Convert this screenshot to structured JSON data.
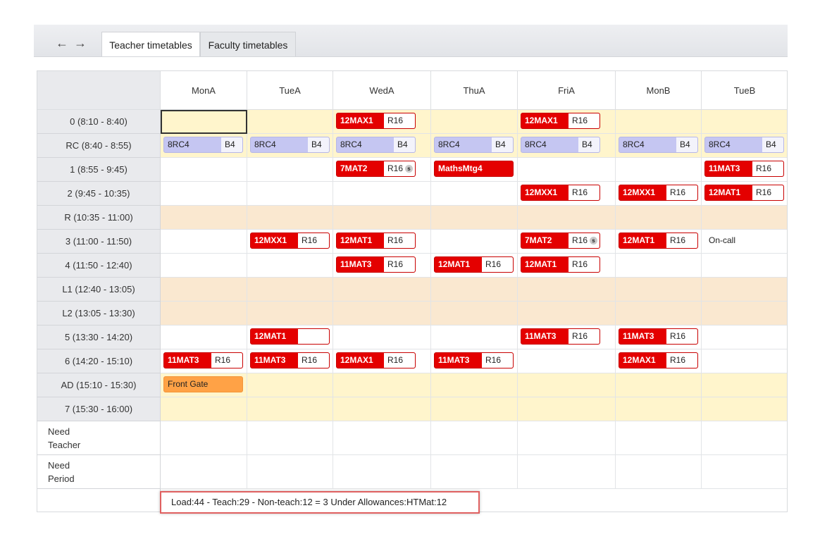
{
  "nav": {
    "back_icon": "←",
    "forward_icon": "→"
  },
  "tabs": [
    {
      "label": "Teacher timetables",
      "active": true
    },
    {
      "label": "Faculty timetables",
      "active": false
    }
  ],
  "days": [
    "MonA",
    "TueA",
    "WedA",
    "ThuA",
    "FriA",
    "MonB",
    "TueB"
  ],
  "rows": [
    {
      "label": "0  (8:10 - 8:40)",
      "kind": "break",
      "cells": [
        {
          "selected": true
        },
        null,
        {
          "t": "red",
          "l": "12MAX1",
          "r": "R16"
        },
        null,
        {
          "t": "red",
          "l": "12MAX1",
          "r": "R16"
        },
        null,
        null
      ]
    },
    {
      "label": "RC  (8:40 - 8:55)",
      "kind": "break",
      "cells": [
        {
          "t": "purple",
          "l": "8RC4",
          "r": "B4"
        },
        {
          "t": "purple",
          "l": "8RC4",
          "r": "B4"
        },
        {
          "t": "purple",
          "l": "8RC4",
          "r": "B4"
        },
        {
          "t": "purple",
          "l": "8RC4",
          "r": "B4"
        },
        {
          "t": "purple",
          "l": "8RC4",
          "r": "B4"
        },
        {
          "t": "purple",
          "l": "8RC4",
          "r": "B4"
        },
        {
          "t": "purple",
          "l": "8RC4",
          "r": "B4"
        }
      ]
    },
    {
      "label": "1  (8:55 - 9:45)",
      "kind": "teach",
      "cells": [
        null,
        null,
        {
          "t": "red",
          "l": "7MAT2",
          "r": "R16",
          "s": "s"
        },
        {
          "t": "redfull",
          "l": "MathsMtg4"
        },
        null,
        null,
        {
          "t": "red",
          "l": "11MAT3",
          "r": "R16"
        }
      ]
    },
    {
      "label": "2  (9:45 - 10:35)",
      "kind": "teach",
      "cells": [
        null,
        null,
        null,
        null,
        {
          "t": "red",
          "l": "12MXX1",
          "r": "R16"
        },
        {
          "t": "red",
          "l": "12MXX1",
          "r": "R16"
        },
        {
          "t": "red",
          "l": "12MAT1",
          "r": "R16"
        }
      ]
    },
    {
      "label": "R  (10:35 - 11:00)",
      "kind": "recess",
      "cells": [
        null,
        null,
        null,
        null,
        null,
        null,
        null
      ]
    },
    {
      "label": "3  (11:00 - 11:50)",
      "kind": "teach",
      "cells": [
        null,
        {
          "t": "red",
          "l": "12MXX1",
          "r": "R16"
        },
        {
          "t": "red",
          "l": "12MAT1",
          "r": "R16"
        },
        null,
        {
          "t": "red",
          "l": "7MAT2",
          "r": "R16",
          "s": "s"
        },
        {
          "t": "red",
          "l": "12MAT1",
          "r": "R16"
        },
        {
          "t": "text",
          "l": "On-call"
        }
      ]
    },
    {
      "label": "4  (11:50 - 12:40)",
      "kind": "teach",
      "cells": [
        null,
        null,
        {
          "t": "red",
          "l": "11MAT3",
          "r": "R16"
        },
        {
          "t": "red",
          "l": "12MAT1",
          "r": "R16"
        },
        {
          "t": "red",
          "l": "12MAT1",
          "r": "R16"
        },
        null,
        null
      ]
    },
    {
      "label": "L1  (12:40 - 13:05)",
      "kind": "recess",
      "cells": [
        null,
        null,
        null,
        null,
        null,
        null,
        null
      ]
    },
    {
      "label": "L2  (13:05 - 13:30)",
      "kind": "recess",
      "cells": [
        null,
        null,
        null,
        null,
        null,
        null,
        null
      ]
    },
    {
      "label": "5  (13:30 - 14:20)",
      "kind": "teach",
      "cells": [
        null,
        {
          "t": "red",
          "l": "12MAT1",
          "r": ""
        },
        null,
        null,
        {
          "t": "red",
          "l": "11MAT3",
          "r": "R16"
        },
        {
          "t": "red",
          "l": "11MAT3",
          "r": "R16"
        },
        null
      ]
    },
    {
      "label": "6  (14:20 - 15:10)",
      "kind": "teach",
      "cells": [
        {
          "t": "red",
          "l": "11MAT3",
          "r": "R16"
        },
        {
          "t": "red",
          "l": "11MAT3",
          "r": "R16"
        },
        {
          "t": "red",
          "l": "12MAX1",
          "r": "R16"
        },
        {
          "t": "red",
          "l": "11MAT3",
          "r": "R16"
        },
        null,
        {
          "t": "red",
          "l": "12MAX1",
          "r": "R16"
        },
        null
      ]
    },
    {
      "label": "AD  (15:10 - 15:30)",
      "kind": "break",
      "cells": [
        {
          "t": "orange",
          "l": "Front Gate"
        },
        null,
        null,
        null,
        null,
        null,
        null
      ]
    },
    {
      "label": "7  (15:30 - 16:00)",
      "kind": "break",
      "cells": [
        null,
        null,
        null,
        null,
        null,
        null,
        null
      ]
    },
    {
      "label": "Need\nTeacher",
      "kind": "need",
      "cells": [
        null,
        null,
        null,
        null,
        null,
        null,
        null
      ]
    },
    {
      "label": "Need\nPeriod",
      "kind": "need",
      "cells": [
        null,
        null,
        null,
        null,
        null,
        null,
        null
      ]
    }
  ],
  "summary": "Load:44 - Teach:29 - Non-teach:12 = 3 Under   Allowances:HTMat:12",
  "colors": {
    "class_red": "#e40000",
    "rollcall_purple": "#c5c6f2",
    "duty_orange": "#ffa246",
    "break_yellow": "#fff5cc",
    "recess_tan": "#fae8d0"
  }
}
